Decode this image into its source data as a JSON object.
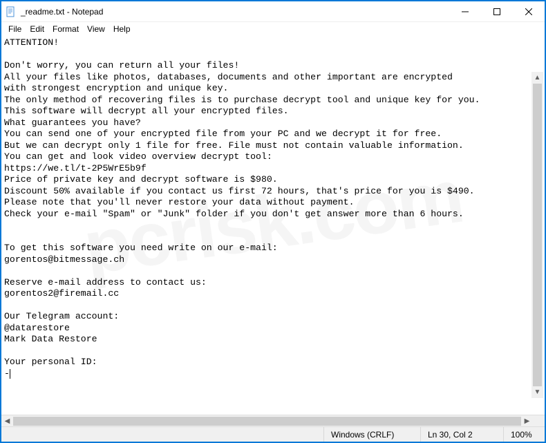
{
  "titlebar": {
    "title": "_readme.txt - Notepad",
    "minimize_glyph": "—",
    "maximize_glyph": "☐",
    "close_glyph": "✕"
  },
  "menubar": {
    "items": [
      "File",
      "Edit",
      "Format",
      "View",
      "Help"
    ]
  },
  "document": {
    "lines": [
      "ATTENTION!",
      "",
      "Don't worry, you can return all your files!",
      "All your files like photos, databases, documents and other important are encrypted",
      "with strongest encryption and unique key.",
      "The only method of recovering files is to purchase decrypt tool and unique key for you.",
      "This software will decrypt all your encrypted files.",
      "What guarantees you have?",
      "You can send one of your encrypted file from your PC and we decrypt it for free.",
      "But we can decrypt only 1 file for free. File must not contain valuable information.",
      "You can get and look video overview decrypt tool:",
      "https://we.tl/t-2P5WrE5b9f",
      "Price of private key and decrypt software is $980.",
      "Discount 50% available if you contact us first 72 hours, that's price for you is $490.",
      "Please note that you'll never restore your data without payment.",
      "Check your e-mail \"Spam\" or \"Junk\" folder if you don't get answer more than 6 hours.",
      "",
      "",
      "To get this software you need write on our e-mail:",
      "gorentos@bitmessage.ch",
      "",
      "Reserve e-mail address to contact us:",
      "gorentos2@firemail.cc",
      "",
      "Our Telegram account:",
      "@datarestore",
      "Mark Data Restore",
      "",
      "Your personal ID:",
      "-"
    ]
  },
  "statusbar": {
    "line_ending": "Windows (CRLF)",
    "cursor_pos": "Ln 30, Col 2",
    "zoom": "100%"
  },
  "scroll": {
    "left_arrow": "◀",
    "right_arrow": "▶",
    "up_arrow": "▲",
    "down_arrow": "▼"
  }
}
